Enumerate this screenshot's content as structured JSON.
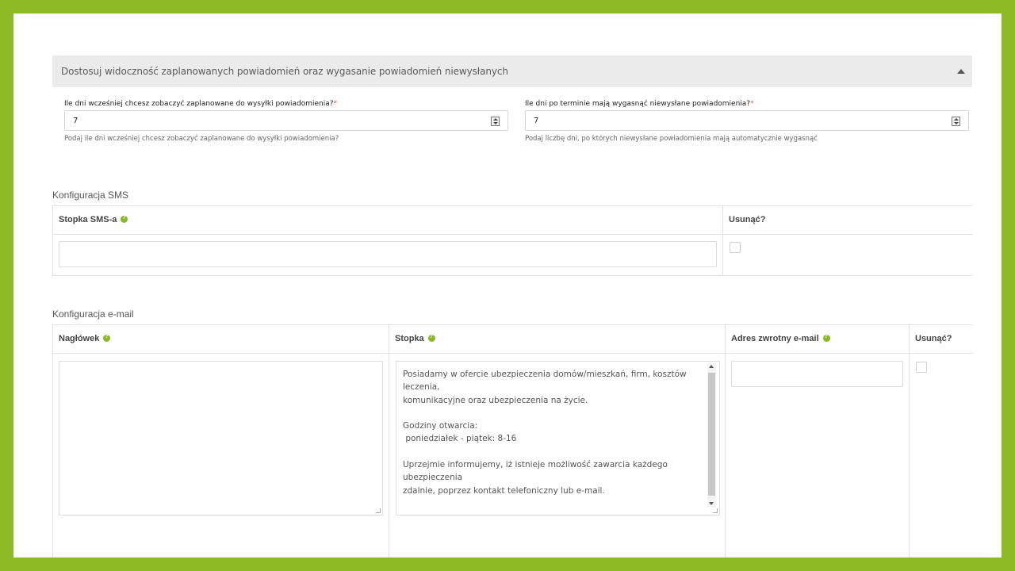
{
  "panel": {
    "title": "Dostosuj widoczność zaplanowanych powiadomień oraz wygasanie powiadomień niewysłanych"
  },
  "fields": {
    "days_before": {
      "label": "Ile dni wcześniej chcesz zobaczyć zaplanowane do wysyłki powiadomienia?",
      "required_mark": "*",
      "value": "7",
      "help": "Podaj ile dni wcześniej chcesz zobaczyć zaplanowane do wysyłki powiadomienia?"
    },
    "days_expire": {
      "label": "Ile dni po terminie mają wygasnąć niewysłane powiadomienia?",
      "required_mark": "*",
      "value": "7",
      "help": "Podaj liczbę dni, po których niewysłane powiadomienia mają automatycznie wygasnąć"
    }
  },
  "sms": {
    "section_title": "Konfiguracja SMS",
    "columns": {
      "footer": "Stopka SMS-a",
      "delete": "Usunąć?"
    },
    "row": {
      "footer_value": "",
      "delete_checked": false
    }
  },
  "email": {
    "section_title": "Konfiguracja e-mail",
    "columns": {
      "header": "Nagłówek",
      "footer": "Stopka",
      "return_address": "Adres zwrotny e-mail",
      "delete": "Usunąć?"
    },
    "row": {
      "header_value": "",
      "footer_value": "Posiadamy w ofercie ubezpieczenia domów/mieszkań, firm, kosztów leczenia,\nkomunikacyjne oraz ubezpieczenia na życie.\n\nGodziny otwarcia:\n poniedziałek - piątek: 8-16\n\nUprzejmie informujemy, iż istnieje możliwość zawarcia każdego ubezpieczenia\nzdalnie, poprzez kontakt telefoniczny lub e-mail.",
      "return_address_value": "",
      "delete_checked": false
    }
  },
  "colors": {
    "frame": "#8bba25",
    "help_icon": "#8ab82d",
    "required": "#d9534f",
    "panel_header": "#ebebeb"
  },
  "icons": {
    "collapse": "caret-up-icon",
    "help": "question-circle-icon",
    "spinner": "number-spinner-icon"
  }
}
